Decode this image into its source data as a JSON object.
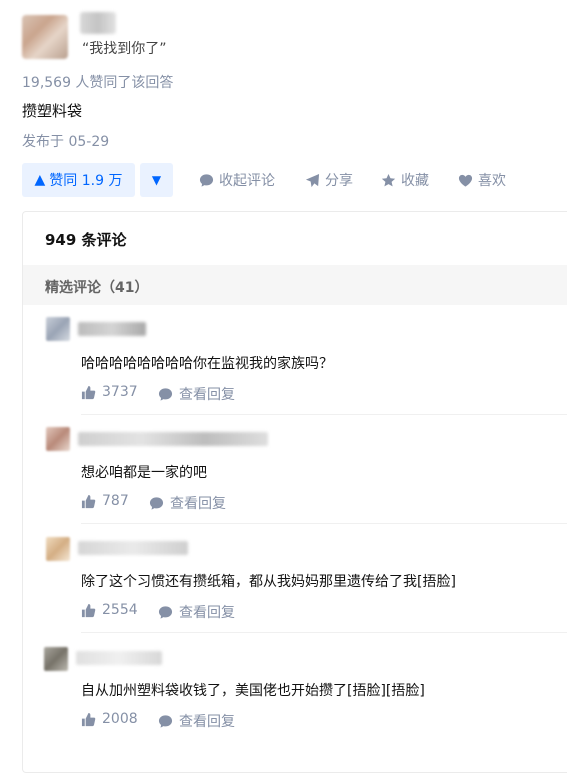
{
  "answer": {
    "headline": "“我找到你了”",
    "agree_count_text": "19,569 人赞同了该回答",
    "body": "攒塑料袋",
    "published": "发布于 05-29"
  },
  "actions": {
    "vote_up_label": "赞同 1.9 万",
    "collapse_comments_label": "收起评论",
    "share_label": "分享",
    "favorite_label": "收藏",
    "like_label": "喜欢"
  },
  "comments": {
    "count_label": "949 条评论",
    "featured_label": "精选评论（41）",
    "view_reply_label": "查看回复",
    "items": [
      {
        "text": "哈哈哈哈哈哈哈哈你在监视我的家族吗？",
        "likes": "3737"
      },
      {
        "text": "想必咱都是一家的吧",
        "likes": "787"
      },
      {
        "text": "除了这个习惯还有攒纸箱，都从我妈妈那里遗传给了我[捂脸]",
        "likes": "2554"
      },
      {
        "text": "自从加州塑料袋收钱了，美国佬也开始攒了[捂脸][捂脸]",
        "likes": "2008"
      }
    ]
  },
  "colors": {
    "accent": "#0066ff",
    "accent_bg": "#eaf2ff",
    "muted": "#8590a6"
  }
}
